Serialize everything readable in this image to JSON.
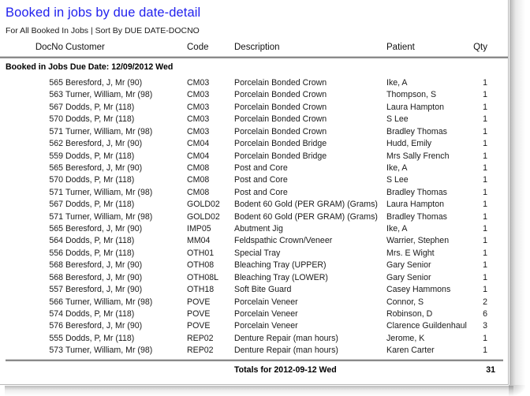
{
  "report": {
    "title": "Booked in jobs by due date-detail",
    "subtitle": "For All Booked In Jobs | Sort By DUE DATE-DOCNO",
    "title_color": "#2222ee"
  },
  "columns": {
    "docno": "DocNo",
    "customer": "Customer",
    "code": "Code",
    "description": "Description",
    "patient": "Patient",
    "qty": "Qty"
  },
  "group": {
    "header": "Booked in Jobs Due Date: 12/09/2012 Wed"
  },
  "rows": [
    {
      "docno": "565",
      "customer": "Beresford, J, Mr (90)",
      "code": "CM03",
      "description": "Porcelain Bonded Crown",
      "patient": "Ike, A",
      "qty": "1"
    },
    {
      "docno": "563",
      "customer": "Turner, William, Mr (98)",
      "code": "CM03",
      "description": "Porcelain Bonded Crown",
      "patient": "Thompson, S",
      "qty": "1"
    },
    {
      "docno": "567",
      "customer": "Dodds, P, Mr (118)",
      "code": "CM03",
      "description": "Porcelain Bonded Crown",
      "patient": "Laura Hampton",
      "qty": "1"
    },
    {
      "docno": "570",
      "customer": "Dodds, P, Mr (118)",
      "code": "CM03",
      "description": "Porcelain Bonded Crown",
      "patient": "S Lee",
      "qty": "1"
    },
    {
      "docno": "571",
      "customer": "Turner, William, Mr (98)",
      "code": "CM03",
      "description": "Porcelain Bonded Crown",
      "patient": "Bradley Thomas",
      "qty": "1"
    },
    {
      "docno": "562",
      "customer": "Beresford, J, Mr (90)",
      "code": "CM04",
      "description": "Porcelain Bonded Bridge",
      "patient": "Hudd, Emily",
      "qty": "1"
    },
    {
      "docno": "559",
      "customer": "Dodds, P, Mr (118)",
      "code": "CM04",
      "description": "Porcelain Bonded Bridge",
      "patient": "Mrs Sally French",
      "qty": "1"
    },
    {
      "docno": "565",
      "customer": "Beresford, J, Mr (90)",
      "code": "CM08",
      "description": "Post and Core",
      "patient": "Ike, A",
      "qty": "1"
    },
    {
      "docno": "570",
      "customer": "Dodds, P, Mr (118)",
      "code": "CM08",
      "description": "Post and Core",
      "patient": "S Lee",
      "qty": "1"
    },
    {
      "docno": "571",
      "customer": "Turner, William, Mr (98)",
      "code": "CM08",
      "description": "Post and Core",
      "patient": "Bradley Thomas",
      "qty": "1"
    },
    {
      "docno": "567",
      "customer": "Dodds, P, Mr (118)",
      "code": "GOLD02",
      "description": "Bodent 60 Gold (PER GRAM) (Grams)",
      "patient": "Laura Hampton",
      "qty": "1"
    },
    {
      "docno": "571",
      "customer": "Turner, William, Mr (98)",
      "code": "GOLD02",
      "description": "Bodent 60 Gold (PER GRAM) (Grams)",
      "patient": "Bradley Thomas",
      "qty": "1"
    },
    {
      "docno": "565",
      "customer": "Beresford, J, Mr (90)",
      "code": "IMP05",
      "description": "Abutment Jig",
      "patient": "Ike, A",
      "qty": "1"
    },
    {
      "docno": "564",
      "customer": "Dodds, P, Mr (118)",
      "code": "MM04",
      "description": "Feldspathic Crown/Veneer",
      "patient": "Warrier, Stephen",
      "qty": "1"
    },
    {
      "docno": "556",
      "customer": "Dodds, P, Mr (118)",
      "code": "OTH01",
      "description": "Special Tray",
      "patient": "Mrs. E Wight",
      "qty": "1"
    },
    {
      "docno": "568",
      "customer": "Beresford, J, Mr (90)",
      "code": "OTH08",
      "description": "Bleaching Tray (UPPER)",
      "patient": "Gary Senior",
      "qty": "1"
    },
    {
      "docno": "568",
      "customer": "Beresford, J, Mr (90)",
      "code": "OTH08L",
      "description": "Bleaching Tray (LOWER)",
      "patient": "Gary Senior",
      "qty": "1"
    },
    {
      "docno": "557",
      "customer": "Beresford, J, Mr (90)",
      "code": "OTH18",
      "description": "Soft Bite Guard",
      "patient": "Casey Hammons",
      "qty": "1"
    },
    {
      "docno": "566",
      "customer": "Turner, William, Mr (98)",
      "code": "POVE",
      "description": "Porcelain Veneer",
      "patient": "Connor, S",
      "qty": "2"
    },
    {
      "docno": "574",
      "customer": "Dodds, P, Mr (118)",
      "code": "POVE",
      "description": "Porcelain Veneer",
      "patient": "Robinson, D",
      "qty": "6"
    },
    {
      "docno": "576",
      "customer": "Beresford, J, Mr (90)",
      "code": "POVE",
      "description": "Porcelain Veneer",
      "patient": "Clarence Guildenhaul",
      "qty": "3"
    },
    {
      "docno": "555",
      "customer": "Dodds, P, Mr (118)",
      "code": "REP02",
      "description": "Denture Repair (man hours)",
      "patient": "Jerome, K",
      "qty": "1"
    },
    {
      "docno": "573",
      "customer": "Turner, William, Mr (98)",
      "code": "REP02",
      "description": "Denture Repair (man hours)",
      "patient": "Karen Carter",
      "qty": "1"
    }
  ],
  "totals": {
    "label": "Totals for 2012-09-12 Wed",
    "value": "31"
  }
}
